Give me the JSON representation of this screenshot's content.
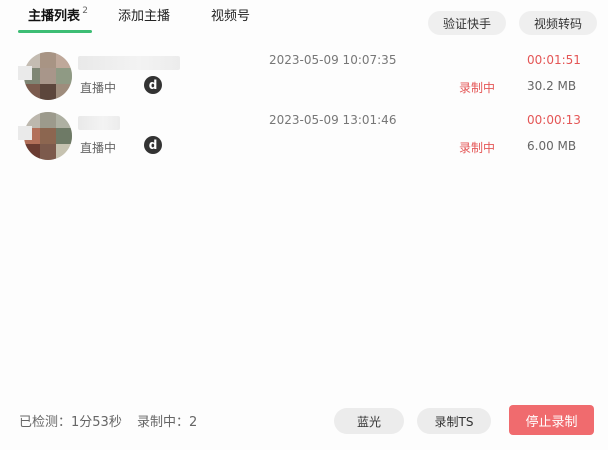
{
  "tabs": [
    {
      "label": "主播列表",
      "badge": "2",
      "active": true
    },
    {
      "label": "添加主播",
      "active": false
    },
    {
      "label": "视频号",
      "active": false
    }
  ],
  "header_buttons": {
    "verify": "验证快手",
    "transcode": "视频转码"
  },
  "streamers": [
    {
      "status": "直播中",
      "platform_icon": "d",
      "timestamp": "2023-05-09 10:07:35",
      "recording_status": "录制中",
      "duration": "00:01:51",
      "size": "30.2 MB"
    },
    {
      "status": "直播中",
      "platform_icon": "d",
      "timestamp": "2023-05-09 13:01:46",
      "recording_status": "录制中",
      "duration": "00:00:13",
      "size": "6.00 MB"
    }
  ],
  "footer": {
    "checked": "已检测：1分53秒",
    "recording_count": "录制中：2",
    "bluray_button": "蓝光",
    "record_ts_button": "录制TS",
    "stop_button": "停止录制"
  },
  "colors": {
    "accent_green": "#3dbd74",
    "recording_red": "#e45656",
    "stop_button": "#f06b6e"
  }
}
